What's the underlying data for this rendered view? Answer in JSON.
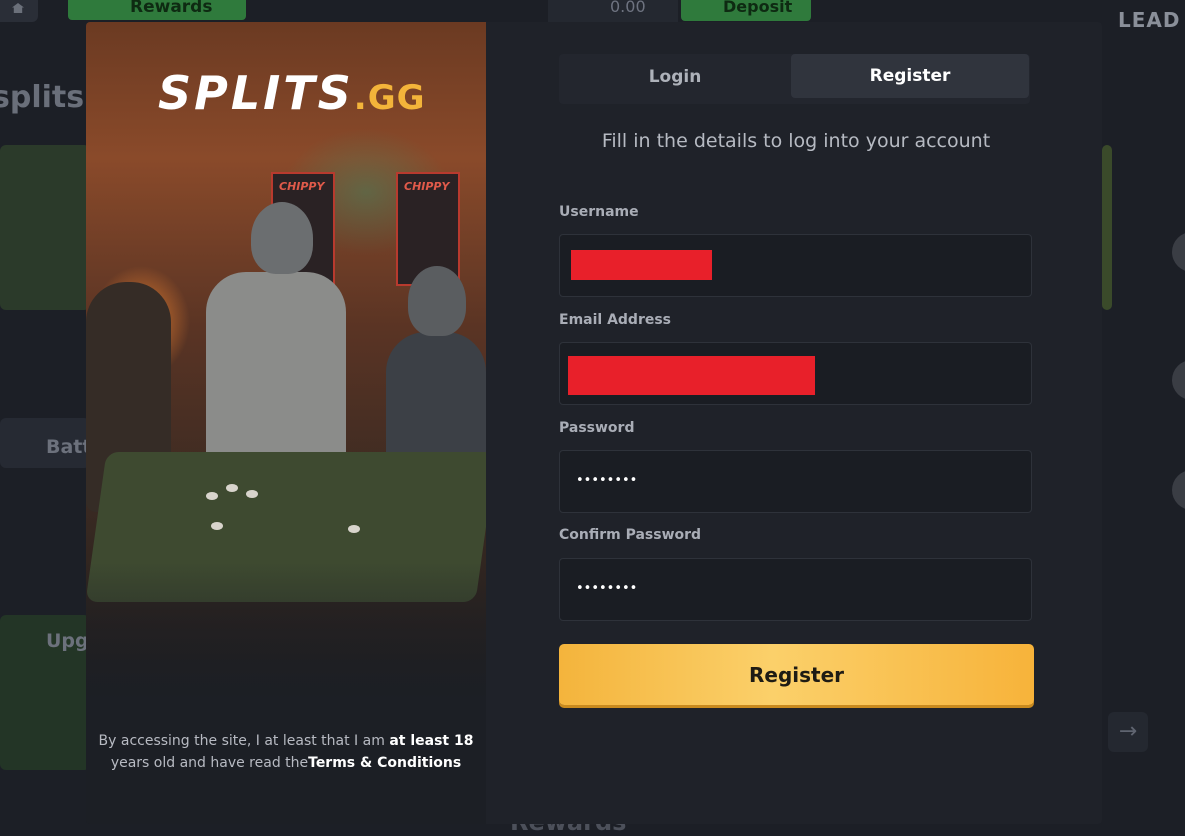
{
  "background": {
    "rewards_label": "Rewards",
    "balance": "0.00",
    "deposit_label": "Deposit",
    "leaderboard_label": "LEAD",
    "site_name": "splits.",
    "battles_label": "Batt",
    "upgrader_label": "Upg",
    "bottom_rewards": "Rewards"
  },
  "hero": {
    "logo_main": "SPLITS",
    "logo_suffix": ".GG",
    "arcade_label": "CHIPPY",
    "disclaimer_pre": "By accessing the site, I at least that I am ",
    "disclaimer_age": "at least 18",
    "disclaimer_mid": " years old and have read the",
    "disclaimer_link": "Terms & Conditions"
  },
  "tabs": {
    "login": "Login",
    "register": "Register",
    "active": "register"
  },
  "form": {
    "subtitle": "Fill in the details to log into your account",
    "username_label": "Username",
    "username_value": "[redacted]",
    "email_label": "Email Address",
    "email_value": "[redacted]",
    "password_label": "Password",
    "password_value": "••••••••",
    "confirm_label": "Confirm Password",
    "confirm_value": "••••••••",
    "submit_label": "Register"
  },
  "colors": {
    "accent": "#f4b43c",
    "modal_bg": "#1f2229",
    "redaction": "#e8202a"
  }
}
